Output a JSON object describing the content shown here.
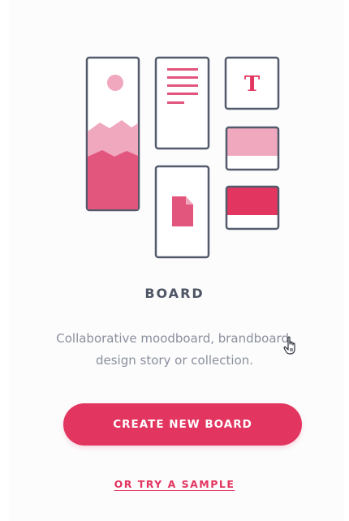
{
  "board": {
    "tile_letter": "T",
    "title": "BOARD",
    "description": "Collaborative moodboard, brandboard, design story or collection."
  },
  "actions": {
    "create_label": "CREATE NEW BOARD",
    "sample_label": "OR TRY A SAMPLE"
  },
  "colors": {
    "accent": "#e2355f",
    "accent_light": "#f0a8bf",
    "outline": "#525a6b",
    "title_text": "#4f5565",
    "body_text": "#8a8f9c"
  },
  "icons": {
    "cursor": "hand-pointer-icon"
  }
}
